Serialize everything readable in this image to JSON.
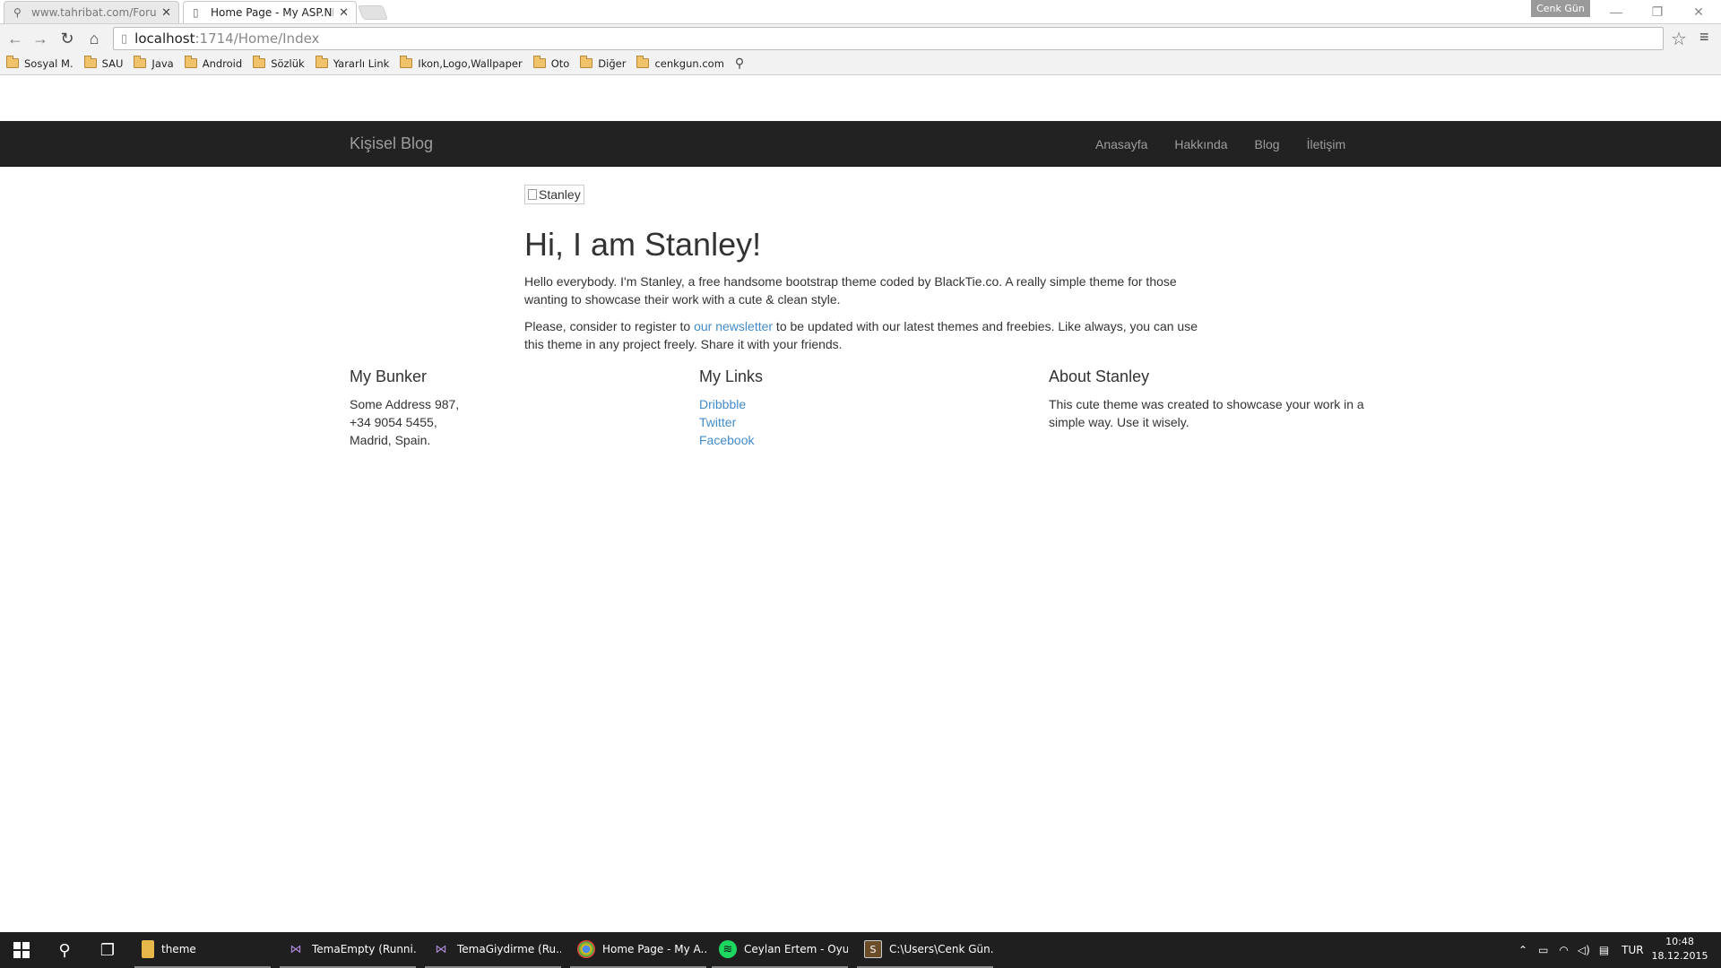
{
  "browser": {
    "tabs": [
      {
        "title": "www.tahribat.com/Forum/",
        "active": false
      },
      {
        "title": "Home Page - My ASP.NET",
        "active": true
      }
    ],
    "user_badge": "Cenk Gün",
    "url_host": "localhost",
    "url_path": ":1714/Home/Index",
    "bookmarks": [
      "Sosyal M.",
      "SAU",
      "Java",
      "Android",
      "Sözlük",
      "Yararlı Link",
      "Ikon,Logo,Wallpaper",
      "Oto",
      "Diğer",
      "cenkgun.com"
    ]
  },
  "site": {
    "brand": "Kişisel Blog",
    "nav": [
      "Anasayfa",
      "Hakkında",
      "Blog",
      "İletişim"
    ],
    "hero": {
      "img_alt": "Stanley",
      "heading": "Hi, I am Stanley!",
      "p1": "Hello everybody. I'm Stanley, a free handsome bootstrap theme coded by BlackTie.co. A really simple theme for those wanting to showcase their work with a cute & clean style.",
      "p2_before": "Please, consider to register to ",
      "p2_link": "our newsletter",
      "p2_after": " to be updated with our latest themes and freebies. Like always, you can use this theme in any project freely. Share it with your friends."
    },
    "footer": {
      "bunker": {
        "title": "My Bunker",
        "lines": [
          "Some Address 987,",
          "+34 9054 5455,",
          "Madrid, Spain."
        ]
      },
      "links": {
        "title": "My Links",
        "items": [
          "Dribbble",
          "Twitter",
          "Facebook"
        ]
      },
      "about": {
        "title": "About Stanley",
        "text": "This cute theme was created to showcase your work in a simple way. Use it wisely."
      }
    }
  },
  "taskbar": {
    "apps": [
      {
        "label": "theme",
        "icon": "folder-icon"
      },
      {
        "label": "TemaEmpty (Runni...",
        "icon": "visual-studio-icon"
      },
      {
        "label": "TemaGiydirme (Ru...",
        "icon": "visual-studio-icon"
      },
      {
        "label": "Home Page - My A...",
        "icon": "chrome-icon"
      },
      {
        "label": "Ceylan Ertem - Oyu...",
        "icon": "spotify-icon"
      },
      {
        "label": "C:\\Users\\Cenk Gün...",
        "icon": "cmd-icon"
      }
    ],
    "lang": "TUR",
    "time": "10:48",
    "date": "18.12.2015"
  },
  "colors": {
    "navbar_bg": "#222222",
    "nav_text": "#9d9d9d",
    "link": "#428bca",
    "taskbar_bg": "#1f1f1f"
  }
}
